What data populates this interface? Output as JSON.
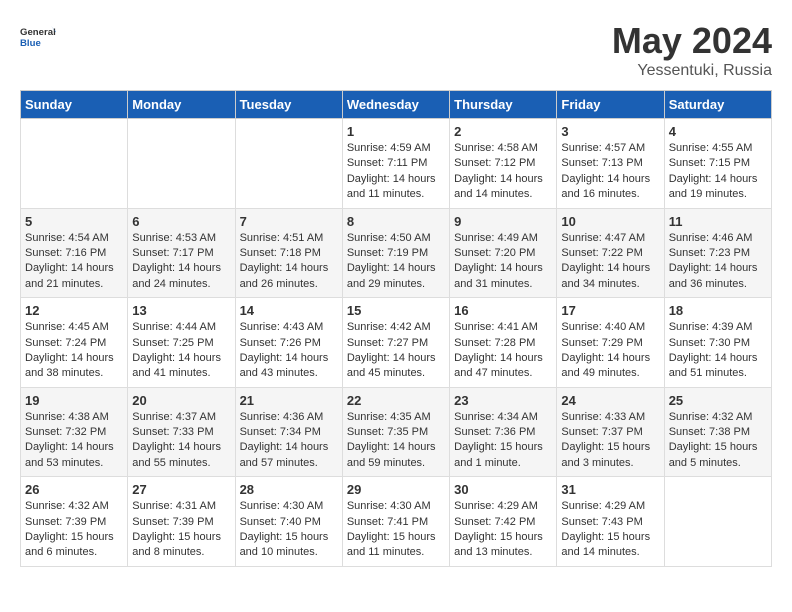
{
  "header": {
    "logo_general": "General",
    "logo_blue": "Blue",
    "month": "May 2024",
    "location": "Yessentuki, Russia"
  },
  "weekdays": [
    "Sunday",
    "Monday",
    "Tuesday",
    "Wednesday",
    "Thursday",
    "Friday",
    "Saturday"
  ],
  "weeks": [
    [
      {
        "day": "",
        "sunrise": "",
        "sunset": "",
        "daylight": ""
      },
      {
        "day": "",
        "sunrise": "",
        "sunset": "",
        "daylight": ""
      },
      {
        "day": "",
        "sunrise": "",
        "sunset": "",
        "daylight": ""
      },
      {
        "day": "1",
        "sunrise": "Sunrise: 4:59 AM",
        "sunset": "Sunset: 7:11 PM",
        "daylight": "Daylight: 14 hours and 11 minutes."
      },
      {
        "day": "2",
        "sunrise": "Sunrise: 4:58 AM",
        "sunset": "Sunset: 7:12 PM",
        "daylight": "Daylight: 14 hours and 14 minutes."
      },
      {
        "day": "3",
        "sunrise": "Sunrise: 4:57 AM",
        "sunset": "Sunset: 7:13 PM",
        "daylight": "Daylight: 14 hours and 16 minutes."
      },
      {
        "day": "4",
        "sunrise": "Sunrise: 4:55 AM",
        "sunset": "Sunset: 7:15 PM",
        "daylight": "Daylight: 14 hours and 19 minutes."
      }
    ],
    [
      {
        "day": "5",
        "sunrise": "Sunrise: 4:54 AM",
        "sunset": "Sunset: 7:16 PM",
        "daylight": "Daylight: 14 hours and 21 minutes."
      },
      {
        "day": "6",
        "sunrise": "Sunrise: 4:53 AM",
        "sunset": "Sunset: 7:17 PM",
        "daylight": "Daylight: 14 hours and 24 minutes."
      },
      {
        "day": "7",
        "sunrise": "Sunrise: 4:51 AM",
        "sunset": "Sunset: 7:18 PM",
        "daylight": "Daylight: 14 hours and 26 minutes."
      },
      {
        "day": "8",
        "sunrise": "Sunrise: 4:50 AM",
        "sunset": "Sunset: 7:19 PM",
        "daylight": "Daylight: 14 hours and 29 minutes."
      },
      {
        "day": "9",
        "sunrise": "Sunrise: 4:49 AM",
        "sunset": "Sunset: 7:20 PM",
        "daylight": "Daylight: 14 hours and 31 minutes."
      },
      {
        "day": "10",
        "sunrise": "Sunrise: 4:47 AM",
        "sunset": "Sunset: 7:22 PM",
        "daylight": "Daylight: 14 hours and 34 minutes."
      },
      {
        "day": "11",
        "sunrise": "Sunrise: 4:46 AM",
        "sunset": "Sunset: 7:23 PM",
        "daylight": "Daylight: 14 hours and 36 minutes."
      }
    ],
    [
      {
        "day": "12",
        "sunrise": "Sunrise: 4:45 AM",
        "sunset": "Sunset: 7:24 PM",
        "daylight": "Daylight: 14 hours and 38 minutes."
      },
      {
        "day": "13",
        "sunrise": "Sunrise: 4:44 AM",
        "sunset": "Sunset: 7:25 PM",
        "daylight": "Daylight: 14 hours and 41 minutes."
      },
      {
        "day": "14",
        "sunrise": "Sunrise: 4:43 AM",
        "sunset": "Sunset: 7:26 PM",
        "daylight": "Daylight: 14 hours and 43 minutes."
      },
      {
        "day": "15",
        "sunrise": "Sunrise: 4:42 AM",
        "sunset": "Sunset: 7:27 PM",
        "daylight": "Daylight: 14 hours and 45 minutes."
      },
      {
        "day": "16",
        "sunrise": "Sunrise: 4:41 AM",
        "sunset": "Sunset: 7:28 PM",
        "daylight": "Daylight: 14 hours and 47 minutes."
      },
      {
        "day": "17",
        "sunrise": "Sunrise: 4:40 AM",
        "sunset": "Sunset: 7:29 PM",
        "daylight": "Daylight: 14 hours and 49 minutes."
      },
      {
        "day": "18",
        "sunrise": "Sunrise: 4:39 AM",
        "sunset": "Sunset: 7:30 PM",
        "daylight": "Daylight: 14 hours and 51 minutes."
      }
    ],
    [
      {
        "day": "19",
        "sunrise": "Sunrise: 4:38 AM",
        "sunset": "Sunset: 7:32 PM",
        "daylight": "Daylight: 14 hours and 53 minutes."
      },
      {
        "day": "20",
        "sunrise": "Sunrise: 4:37 AM",
        "sunset": "Sunset: 7:33 PM",
        "daylight": "Daylight: 14 hours and 55 minutes."
      },
      {
        "day": "21",
        "sunrise": "Sunrise: 4:36 AM",
        "sunset": "Sunset: 7:34 PM",
        "daylight": "Daylight: 14 hours and 57 minutes."
      },
      {
        "day": "22",
        "sunrise": "Sunrise: 4:35 AM",
        "sunset": "Sunset: 7:35 PM",
        "daylight": "Daylight: 14 hours and 59 minutes."
      },
      {
        "day": "23",
        "sunrise": "Sunrise: 4:34 AM",
        "sunset": "Sunset: 7:36 PM",
        "daylight": "Daylight: 15 hours and 1 minute."
      },
      {
        "day": "24",
        "sunrise": "Sunrise: 4:33 AM",
        "sunset": "Sunset: 7:37 PM",
        "daylight": "Daylight: 15 hours and 3 minutes."
      },
      {
        "day": "25",
        "sunrise": "Sunrise: 4:32 AM",
        "sunset": "Sunset: 7:38 PM",
        "daylight": "Daylight: 15 hours and 5 minutes."
      }
    ],
    [
      {
        "day": "26",
        "sunrise": "Sunrise: 4:32 AM",
        "sunset": "Sunset: 7:39 PM",
        "daylight": "Daylight: 15 hours and 6 minutes."
      },
      {
        "day": "27",
        "sunrise": "Sunrise: 4:31 AM",
        "sunset": "Sunset: 7:39 PM",
        "daylight": "Daylight: 15 hours and 8 minutes."
      },
      {
        "day": "28",
        "sunrise": "Sunrise: 4:30 AM",
        "sunset": "Sunset: 7:40 PM",
        "daylight": "Daylight: 15 hours and 10 minutes."
      },
      {
        "day": "29",
        "sunrise": "Sunrise: 4:30 AM",
        "sunset": "Sunset: 7:41 PM",
        "daylight": "Daylight: 15 hours and 11 minutes."
      },
      {
        "day": "30",
        "sunrise": "Sunrise: 4:29 AM",
        "sunset": "Sunset: 7:42 PM",
        "daylight": "Daylight: 15 hours and 13 minutes."
      },
      {
        "day": "31",
        "sunrise": "Sunrise: 4:29 AM",
        "sunset": "Sunset: 7:43 PM",
        "daylight": "Daylight: 15 hours and 14 minutes."
      },
      {
        "day": "",
        "sunrise": "",
        "sunset": "",
        "daylight": ""
      }
    ]
  ]
}
